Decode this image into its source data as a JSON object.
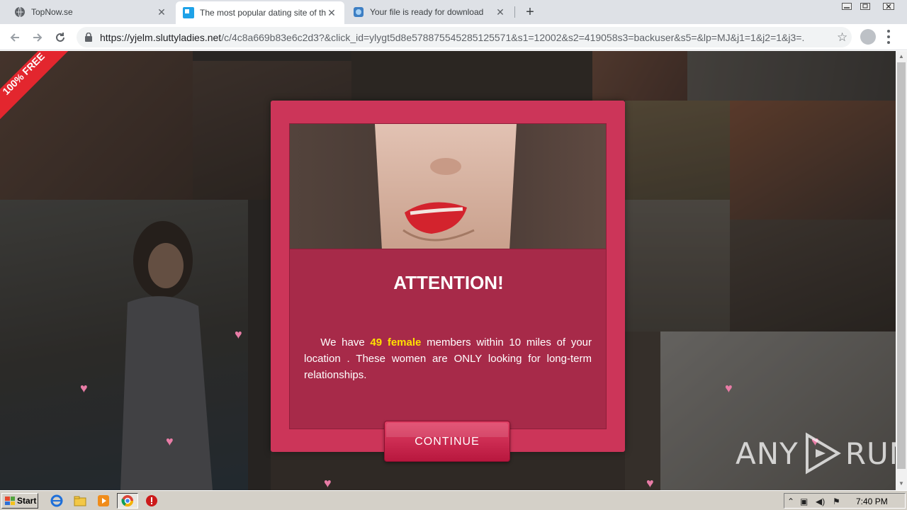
{
  "browser": {
    "tabs": [
      {
        "title": "TopNow.se",
        "active": false
      },
      {
        "title": "The most popular dating site of this r",
        "active": true
      },
      {
        "title": "Your file is ready for download",
        "active": false
      }
    ],
    "new_tab_label": "+",
    "url_host": "https://yjelm.sluttyladies.net",
    "url_path": "/c/4c8a669b83e6c2d3?&click_id=ylygt5d8e578875545285125571&s1=12002&s2=419058s3=backuser&s5=&lp=MJ&j1=1&j2=1&j3=..."
  },
  "page": {
    "ribbon_text": "100% FREE",
    "modal": {
      "title": "ATTENTION!",
      "text_before": "We have ",
      "highlight": "49 female",
      "text_after": " members within 10 miles of your location . These women are ONLY looking for long-term relationships.",
      "button_label": "CONTINUE"
    },
    "watermark": {
      "left": "ANY",
      "right": "RUN"
    }
  },
  "taskbar": {
    "start_label": "Start",
    "clock": "7:40 PM"
  },
  "colors": {
    "modal_bg": "#cc3559",
    "highlight": "#ffe100",
    "ribbon": "#e3262e",
    "heart": "#e87ca6"
  }
}
